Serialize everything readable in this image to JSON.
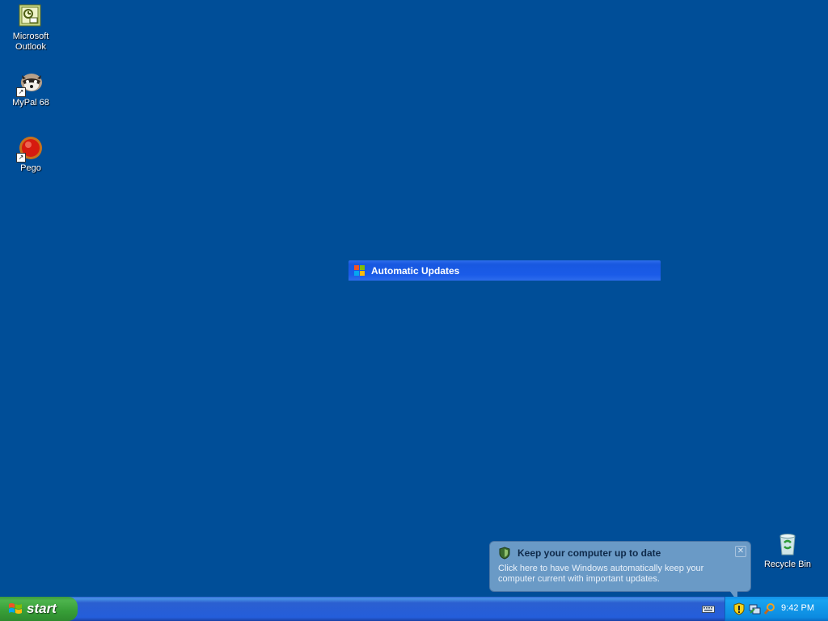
{
  "desktop": {
    "icons": [
      {
        "label_line1": "Microsoft",
        "label_line2": "Outlook"
      },
      {
        "label": "MyPal 68"
      },
      {
        "label": "Pego"
      },
      {
        "label": "Recycle Bin"
      }
    ]
  },
  "auto_updates_window": {
    "title": "Automatic Updates"
  },
  "balloon": {
    "title": "Keep your computer up to date",
    "body": "Click here to have Windows automatically keep your computer current with important updates.",
    "close_glyph": "✕"
  },
  "taskbar": {
    "start_label": "start",
    "clock": "9:42 PM"
  },
  "colors": {
    "desktop": "#004E98",
    "taskbar": "#245EDB",
    "start": "#379E37",
    "tray": "#0C8BE0",
    "balloon": "#6A9AC6"
  }
}
